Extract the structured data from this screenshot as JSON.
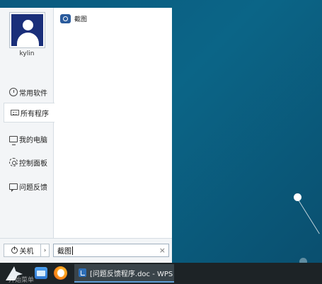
{
  "start_menu": {
    "user": {
      "name": "kylin"
    },
    "nav_items": [
      {
        "label": "常用软件",
        "icon": "clock-icon"
      },
      {
        "label": "所有程序",
        "icon": "grid-icon",
        "active": true
      },
      {
        "label": "我的电脑",
        "icon": "computer-icon"
      },
      {
        "label": "控制面板",
        "icon": "gear-icon"
      },
      {
        "label": "问题反馈",
        "icon": "feedback-icon"
      }
    ],
    "apps": [
      {
        "label": "截图",
        "icon": "camera-icon",
        "icon_color": "#2a5b9c"
      }
    ],
    "power": {
      "label": "关机",
      "menu_glyph": "›"
    },
    "search": {
      "value": "截图",
      "clear_glyph": "×"
    }
  },
  "taskbar": {
    "start_label": "开始菜单",
    "pinned": [
      {
        "name": "file-manager",
        "icon": "file-manager-icon"
      },
      {
        "name": "firefox",
        "icon": "firefox-icon"
      }
    ],
    "tasks": [
      {
        "label": "[问题反馈程序.doc - WPS ...",
        "icon": "wps-writer-icon",
        "active": true
      }
    ]
  },
  "colors": {
    "desktop": "#0b6587",
    "taskbar": "#1d2326",
    "task_active_indicator": "#5f9ed6",
    "avatar_bg": "#1a2f7a"
  }
}
